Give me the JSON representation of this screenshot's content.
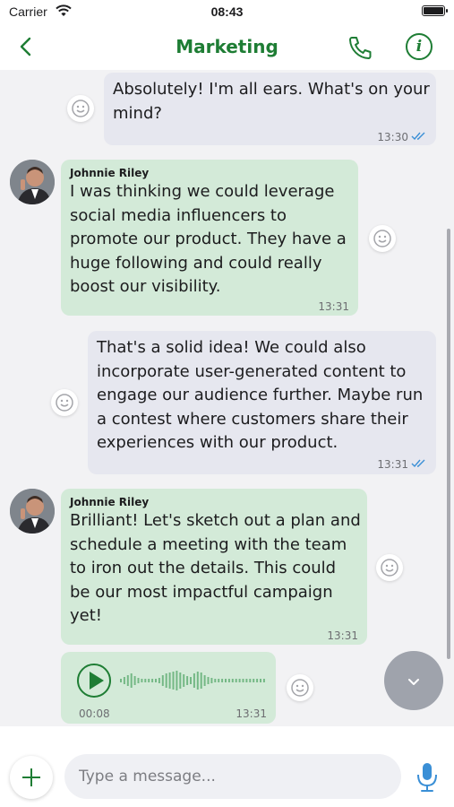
{
  "status_bar": {
    "carrier": "Carrier",
    "time": "08:43"
  },
  "header": {
    "title": "Marketing"
  },
  "messages": [
    {
      "direction": "outgoing",
      "text_lines": [
        "Absolutely! I'm all ears. What's on your",
        "mind?"
      ],
      "time": "13:30",
      "read": true
    },
    {
      "direction": "incoming",
      "sender": "Johnnie Riley",
      "text_lines": [
        "I was thinking we could leverage",
        "social media influencers to",
        "promote our product. They have a",
        "huge following and could really",
        "boost our visibility."
      ],
      "time": "13:31"
    },
    {
      "direction": "outgoing",
      "text_lines": [
        "That's a solid idea! We could also",
        "incorporate user-generated content to",
        "engage our audience further. Maybe run",
        "a contest where customers share their",
        "experiences with our product."
      ],
      "time": "13:31",
      "read": true
    },
    {
      "direction": "incoming",
      "sender": "Johnnie Riley",
      "text_lines": [
        "Brilliant! Let's sketch out a plan and",
        "schedule a meeting with the team",
        "to iron out the details. This could",
        "be our most impactful campaign",
        "yet!"
      ],
      "time": "13:31"
    },
    {
      "direction": "incoming",
      "type": "voice",
      "duration": "00:08",
      "time": "13:31"
    }
  ],
  "composer": {
    "placeholder": "Type a message..."
  },
  "colors": {
    "accent": "#1e7d34",
    "incoming_bubble": "#d3ead8",
    "outgoing_bubble": "#e6e7ef",
    "read_ticks": "#3a8fd6"
  },
  "icons": [
    "chevron-left-icon",
    "phone-icon",
    "info-icon",
    "smiley-icon",
    "double-check-icon",
    "play-icon",
    "waveform-icon",
    "chevron-down-icon",
    "plus-icon",
    "microphone-icon"
  ]
}
